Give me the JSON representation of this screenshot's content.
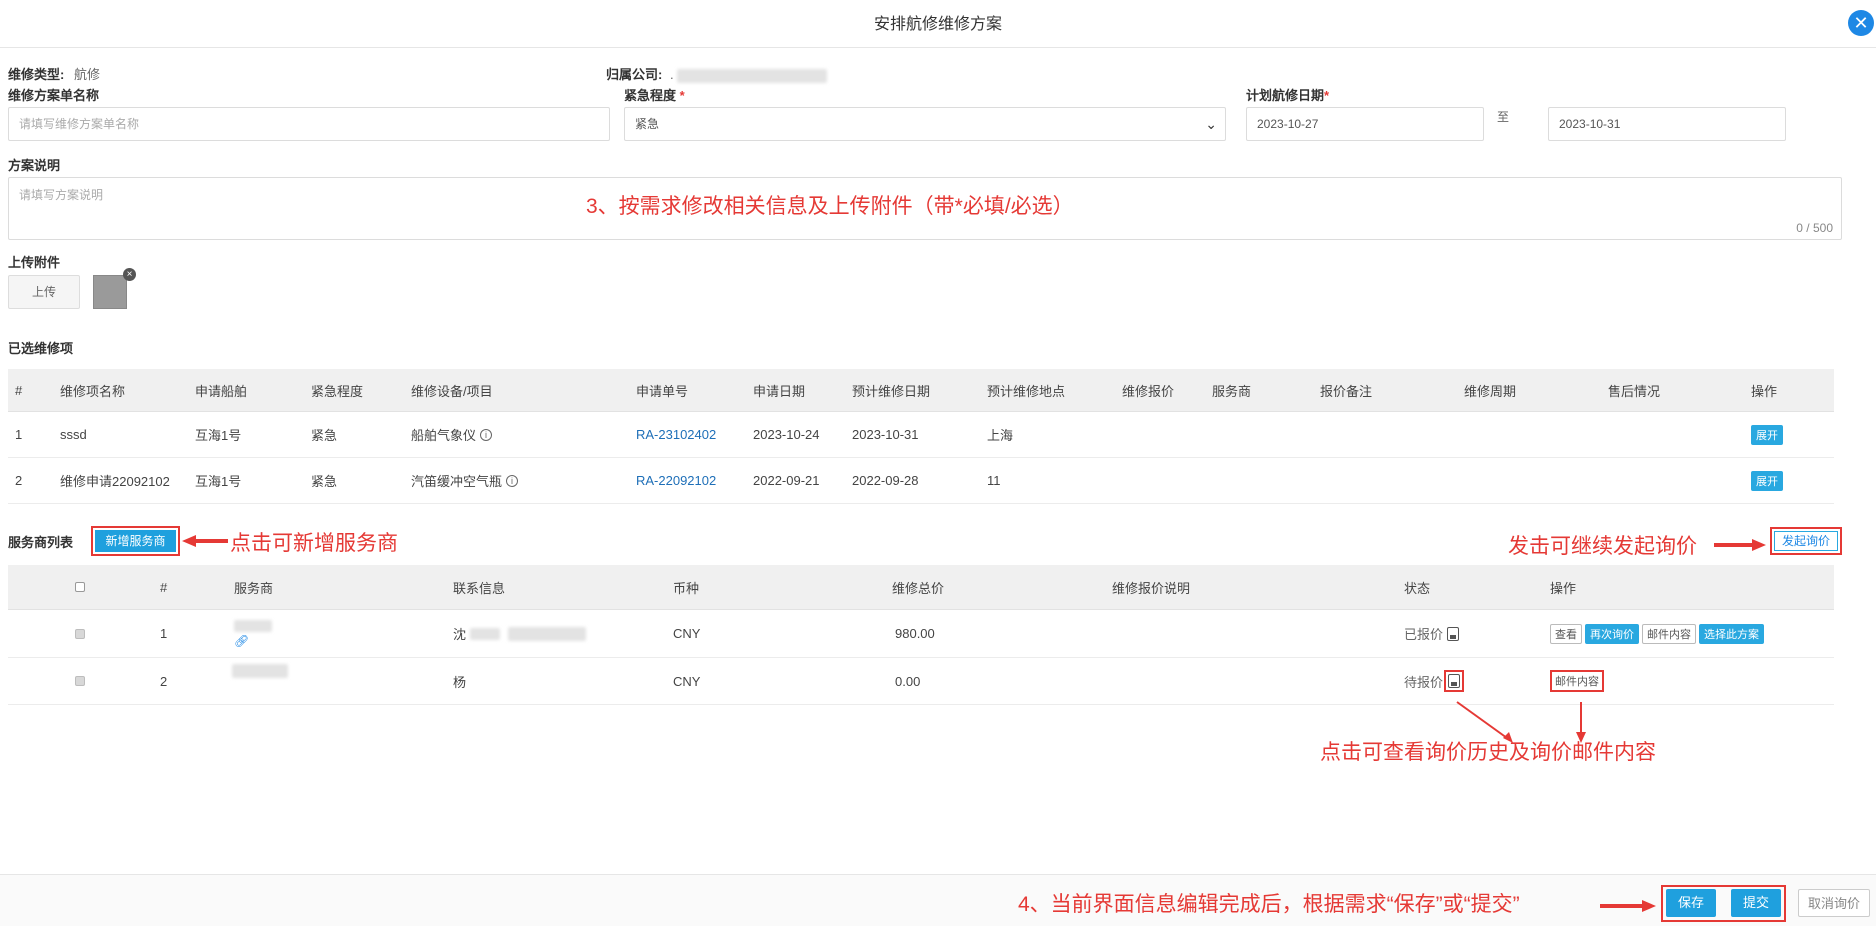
{
  "dialog": {
    "title": "安排航修维修方案",
    "close_icon": "close-icon"
  },
  "form": {
    "repair_type_label": "维修类型:",
    "repair_type_value": "航修",
    "company_label": "归属公司:",
    "company_value": ".",
    "plan_name_label": "维修方案单名称",
    "plan_name_placeholder": "请填写维修方案单名称",
    "urgency_label": "紧急程度",
    "urgency_required": "*",
    "urgency_value": "紧急",
    "planned_date_label": "计划航修日期",
    "planned_date_required": "*",
    "date_start": "2023-10-27",
    "date_sep": "至",
    "date_end": "2023-10-31",
    "desc_label": "方案说明",
    "desc_placeholder": "请填写方案说明",
    "desc_counter": "0 / 500",
    "attach_label": "上传附件",
    "upload_label": "上传"
  },
  "selected_items": {
    "title": "已选维修项",
    "columns": [
      "#",
      "维修项名称",
      "申请船舶",
      "紧急程度",
      "维修设备/项目",
      "申请单号",
      "申请日期",
      "预计维修日期",
      "预计维修地点",
      "维修报价",
      "服务商",
      "报价备注",
      "维修周期",
      "售后情况",
      "操作"
    ],
    "rows": [
      {
        "idx": "1",
        "name": "sssd",
        "ship": "互海1号",
        "urgency": "紧急",
        "equipment": "船舶气象仪",
        "app_no": "RA-23102402",
        "app_date": "2023-10-24",
        "est_date": "2023-10-31",
        "location": "上海",
        "action": "展开"
      },
      {
        "idx": "2",
        "name": "维修申请22092102",
        "ship": "互海1号",
        "urgency": "紧急",
        "equipment": "汽笛缓冲空气瓶",
        "app_no": "RA-22092102",
        "app_date": "2022-09-21",
        "est_date": "2022-09-28",
        "location": "11",
        "action": "展开"
      }
    ]
  },
  "providers": {
    "title": "服务商列表",
    "add_button": "新增服务商",
    "inquiry_button": "发起询价",
    "columns": [
      "",
      "#",
      "服务商",
      "联系信息",
      "币种",
      "维修总价",
      "维修报价说明",
      "状态",
      "操作"
    ],
    "rows": [
      {
        "idx": "1",
        "contact": "沈",
        "currency": "CNY",
        "total": "980.00",
        "status": "已报价",
        "actions": [
          "查看",
          "再次询价",
          "邮件内容",
          "选择此方案"
        ]
      },
      {
        "idx": "2",
        "contact": "杨",
        "currency": "CNY",
        "total": "0.00",
        "status": "待报价",
        "actions": [
          "邮件内容"
        ]
      }
    ]
  },
  "annotations": {
    "step3": "3、按需求修改相关信息及上传附件（带*必填/必选）",
    "add_sp": "点击可新增服务商",
    "re_inquiry": "发击可继续发起询价",
    "history": "点击可查看询价历史及询价邮件内容",
    "step4": "4、当前界面信息编辑完成后，根据需求“保存”或“提交”"
  },
  "footer": {
    "save": "保存",
    "submit": "提交",
    "cancel_inquiry": "取消询价"
  },
  "colors": {
    "primary": "#1fa0de",
    "annotation": "#e53935",
    "link": "#1e6fb8"
  }
}
